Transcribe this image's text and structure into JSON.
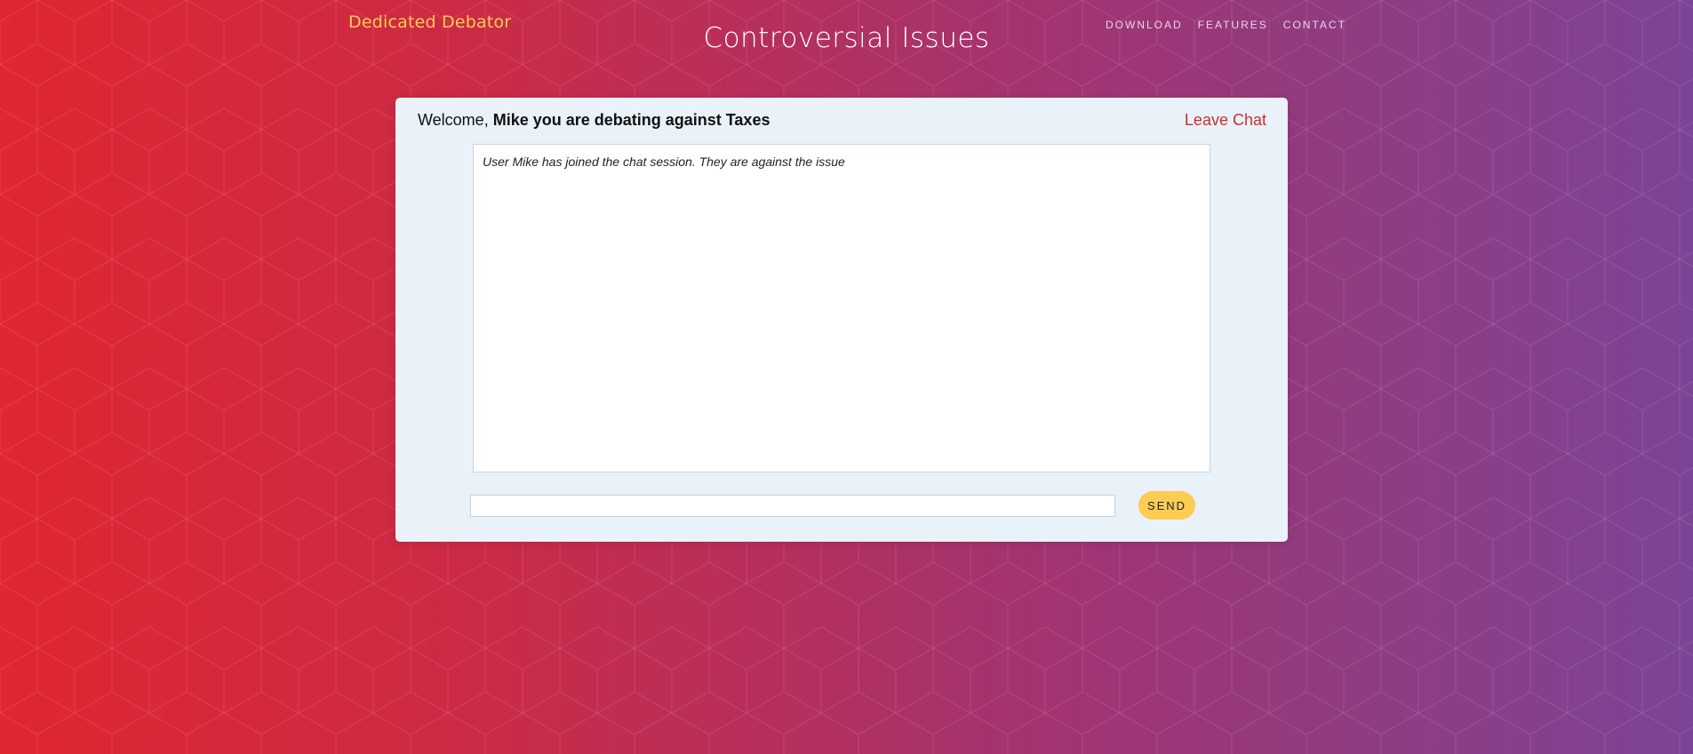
{
  "header": {
    "brand": "Dedicated Debator",
    "title": "Controversial Issues",
    "nav": [
      "DOWNLOAD",
      "FEATURES",
      "CONTACT"
    ]
  },
  "chat": {
    "welcome_prefix": "Welcome, ",
    "welcome_bold": "Mike you are debating against Taxes",
    "leave_label": "Leave Chat",
    "messages": [
      "User Mike has joined the chat session. They are against the issue"
    ],
    "input_value": "",
    "send_label": "SEND"
  },
  "colors": {
    "brand": "#fdcc52",
    "accent_button": "#fdcc52",
    "leave_link": "#c9302c",
    "card_bg": "#e9f1f9",
    "gradient_left": "#e0262f",
    "gradient_right": "#7c4494"
  }
}
